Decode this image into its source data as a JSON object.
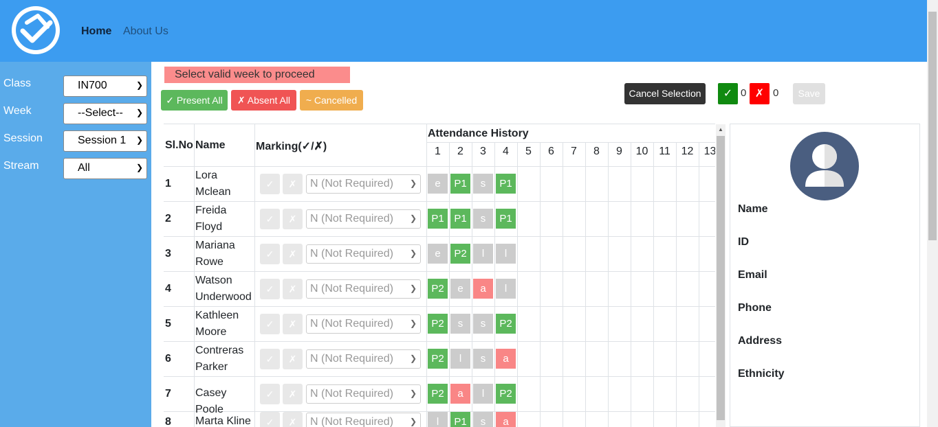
{
  "nav": {
    "home": "Home",
    "about": "About Us"
  },
  "sidebar": {
    "fields": [
      {
        "label": "Class",
        "value": "IN700"
      },
      {
        "label": "Week",
        "value": "--Select--"
      },
      {
        "label": "Session",
        "value": "Session 1"
      },
      {
        "label": "Stream",
        "value": "All"
      }
    ]
  },
  "warning": "Select valid week to proceed",
  "toolbar": {
    "present_all": "✓ Present All",
    "absent_all": "✗ Absent All",
    "cancelled": "~ Cancelled",
    "cancel_selection": "Cancel Selection",
    "present_icon": "✓",
    "present_count": "0",
    "absent_icon": "✗",
    "absent_count": "0",
    "save": "Save"
  },
  "table": {
    "headers": {
      "slno": "Sl.No",
      "name": "Name",
      "marking": "Marking(✓/✗)",
      "history": "Attendance History"
    },
    "week_cols": [
      "1",
      "2",
      "3",
      "4",
      "5",
      "6",
      "7",
      "8",
      "9",
      "10",
      "11",
      "12",
      "13"
    ],
    "mark_present": "✓",
    "mark_absent": "✗",
    "rows": [
      {
        "no": "1",
        "name": "Lora Mclean",
        "reason": "N (Not Required)",
        "history": [
          "e",
          "P1",
          "s",
          "P1"
        ]
      },
      {
        "no": "2",
        "name": "Freida Floyd",
        "reason": "N (Not Required)",
        "history": [
          "P1",
          "P1",
          "s",
          "P1"
        ]
      },
      {
        "no": "3",
        "name": "Mariana Rowe",
        "reason": "N (Not Required)",
        "history": [
          "e",
          "P2",
          "l",
          "l"
        ]
      },
      {
        "no": "4",
        "name": "Watson Underwood",
        "reason": "N (Not Required)",
        "history": [
          "P2",
          "e",
          "a",
          "l"
        ]
      },
      {
        "no": "5",
        "name": "Kathleen Moore",
        "reason": "N (Not Required)",
        "history": [
          "P2",
          "s",
          "s",
          "P2"
        ]
      },
      {
        "no": "6",
        "name": "Contreras Parker",
        "reason": "N (Not Required)",
        "history": [
          "P2",
          "l",
          "s",
          "a"
        ]
      },
      {
        "no": "7",
        "name": "Casey Poole",
        "reason": "N (Not Required)",
        "history": [
          "P2",
          "a",
          "l",
          "P2"
        ]
      },
      {
        "no": "8",
        "name": "Marta Kline",
        "reason": "N (Not Required)",
        "history": [
          "l",
          "P1",
          "s",
          "a"
        ]
      }
    ]
  },
  "profile": {
    "labels": [
      "Name",
      "ID",
      "Email",
      "Phone",
      "Address",
      "Ethnicity"
    ]
  },
  "colors": {
    "present": "#5cb85c",
    "absent": "#f98686",
    "other": "#cccccc",
    "nav": "#3c9cf0",
    "sidebar": "#5aabea"
  },
  "icons": {
    "logo": "checkmark-logo-icon",
    "avatar": "user-avatar-icon",
    "dropdown": "chevron-down-icon"
  }
}
